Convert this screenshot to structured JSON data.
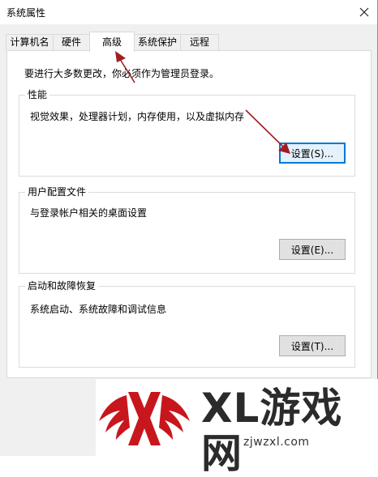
{
  "window": {
    "title": "系统属性"
  },
  "tabs": [
    {
      "label": "计算机名"
    },
    {
      "label": "硬件"
    },
    {
      "label": "高级"
    },
    {
      "label": "系统保护"
    },
    {
      "label": "远程"
    }
  ],
  "active_tab": "高级",
  "notice": "要进行大多数更改，你必须作为管理员登录。",
  "groups": {
    "performance": {
      "title": "性能",
      "description": "视觉效果，处理器计划，内存使用，以及虚拟内存",
      "button": "设置(S)..."
    },
    "user_profiles": {
      "title": "用户配置文件",
      "description": "与登录帐户相关的桌面设置",
      "button": "设置(E)..."
    },
    "startup_recovery": {
      "title": "启动和故障恢复",
      "description": "系统启动、系统故障和调试信息",
      "button": "设置(T)..."
    }
  },
  "watermark": {
    "brand": "XL游戏网",
    "url": "zjwzxl.com"
  },
  "colors": {
    "accent": "#0078d7",
    "annotation_arrow": "#a01e23",
    "logo_red": "#c8161d"
  },
  "icons": {
    "close": "close-icon",
    "logo": "xl-wings-logo"
  }
}
